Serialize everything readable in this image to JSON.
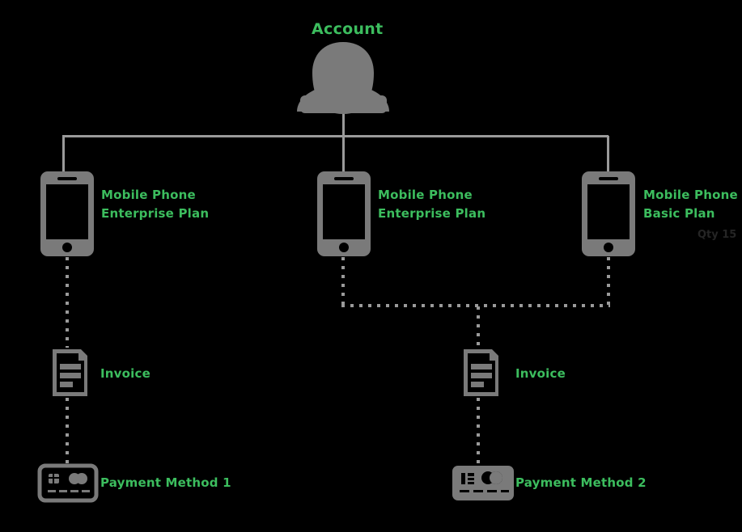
{
  "diagram": {
    "title": "Account",
    "background_color": "#000000",
    "label_color": "#3cbd5e",
    "icon_color": "#7a7a7a",
    "connector_color": "#9a9a9a",
    "nodes": {
      "account": {
        "label": "Account",
        "icon": "person-avatar-icon"
      },
      "phone_1": {
        "label_line_1": "Mobile Phone",
        "label_line_2": "Enterprise Plan",
        "icon": "mobile-phone-icon"
      },
      "phone_2": {
        "label_line_1": "Mobile Phone",
        "label_line_2": "Enterprise Plan",
        "icon": "mobile-phone-icon"
      },
      "phone_3": {
        "label_line_1": "Mobile Phone",
        "label_line_2": "Basic Plan",
        "icon": "mobile-phone-icon",
        "faint_note": "Qty 15"
      },
      "invoice_1": {
        "label": "Invoice",
        "icon": "document-invoice-icon"
      },
      "invoice_2": {
        "label": "Invoice",
        "icon": "document-invoice-icon"
      },
      "payment_1": {
        "label": "Payment Method 1",
        "icon": "credit-card-outline-icon"
      },
      "payment_2": {
        "label": "Payment Method 2",
        "icon": "credit-card-filled-icon"
      }
    }
  }
}
